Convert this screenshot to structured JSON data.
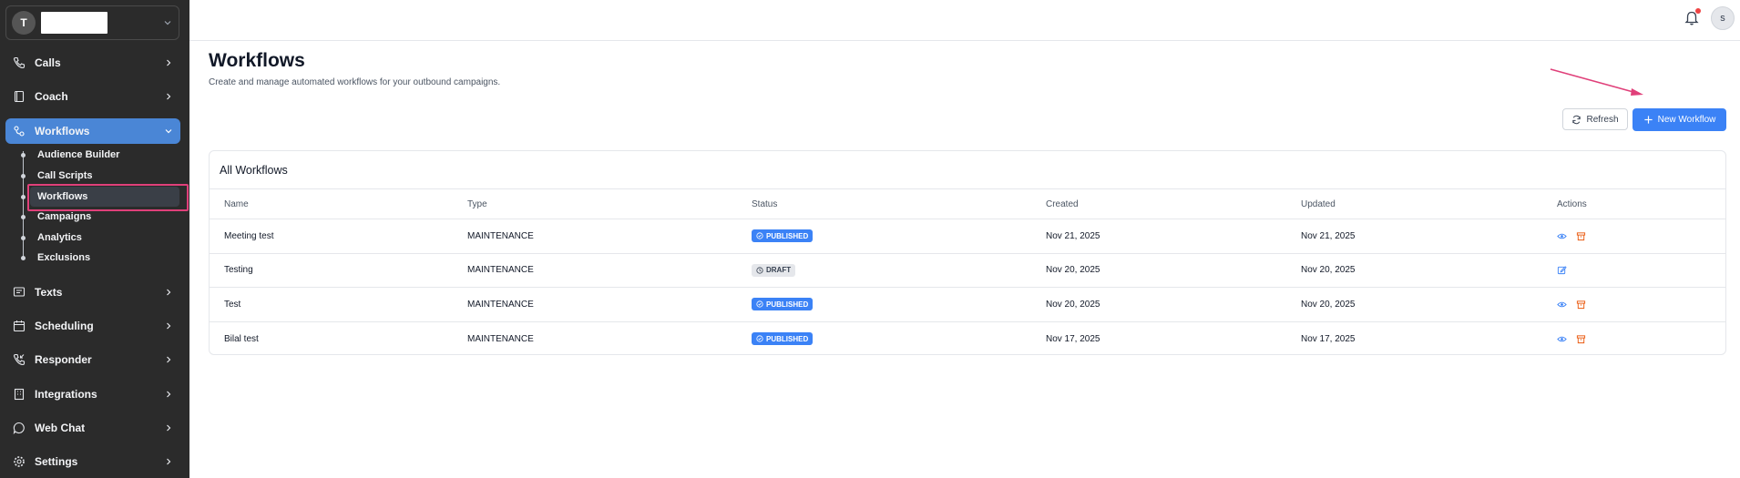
{
  "sidebar": {
    "workspace": {
      "avatar_letter": "T",
      "name": ""
    },
    "nav": [
      {
        "label": "Calls",
        "icon": "phone-icon"
      },
      {
        "label": "Coach",
        "icon": "book-icon"
      },
      {
        "label": "Workflows",
        "icon": "workflow-icon",
        "active": true
      },
      {
        "label": "Texts",
        "icon": "message-icon"
      },
      {
        "label": "Scheduling",
        "icon": "calendar-icon"
      },
      {
        "label": "Responder",
        "icon": "phone-incoming-icon"
      },
      {
        "label": "Integrations",
        "icon": "building-icon"
      },
      {
        "label": "Web Chat",
        "icon": "chat-bubble-icon"
      },
      {
        "label": "Settings",
        "icon": "gear-icon"
      }
    ],
    "workflows_sub": [
      "Audience Builder",
      "Call Scripts",
      "Workflows",
      "Campaigns",
      "Analytics",
      "Exclusions"
    ]
  },
  "topbar": {
    "user_initial": "s"
  },
  "page": {
    "title": "Workflows",
    "subtitle": "Create and manage automated workflows for your outbound campaigns."
  },
  "buttons": {
    "refresh": "Refresh",
    "new_workflow": "New Workflow"
  },
  "table": {
    "title": "All Workflows",
    "columns": [
      "Name",
      "Type",
      "Status",
      "Created",
      "Updated",
      "Actions"
    ],
    "rows": [
      {
        "name": "Meeting test",
        "type": "MAINTENANCE",
        "status": "PUBLISHED",
        "created": "Nov 21, 2025",
        "updated": "Nov 21, 2025"
      },
      {
        "name": "Testing",
        "type": "MAINTENANCE",
        "status": "DRAFT",
        "created": "Nov 20, 2025",
        "updated": "Nov 20, 2025"
      },
      {
        "name": "Test",
        "type": "MAINTENANCE",
        "status": "PUBLISHED",
        "created": "Nov 20, 2025",
        "updated": "Nov 20, 2025"
      },
      {
        "name": "Bilal test",
        "type": "MAINTENANCE",
        "status": "PUBLISHED",
        "created": "Nov 17, 2025",
        "updated": "Nov 17, 2025"
      }
    ]
  },
  "colors": {
    "sidebar_bg": "#2b2b2b",
    "accent": "#3b82f6",
    "highlight": "#e0407a",
    "archive": "#ea580c"
  }
}
